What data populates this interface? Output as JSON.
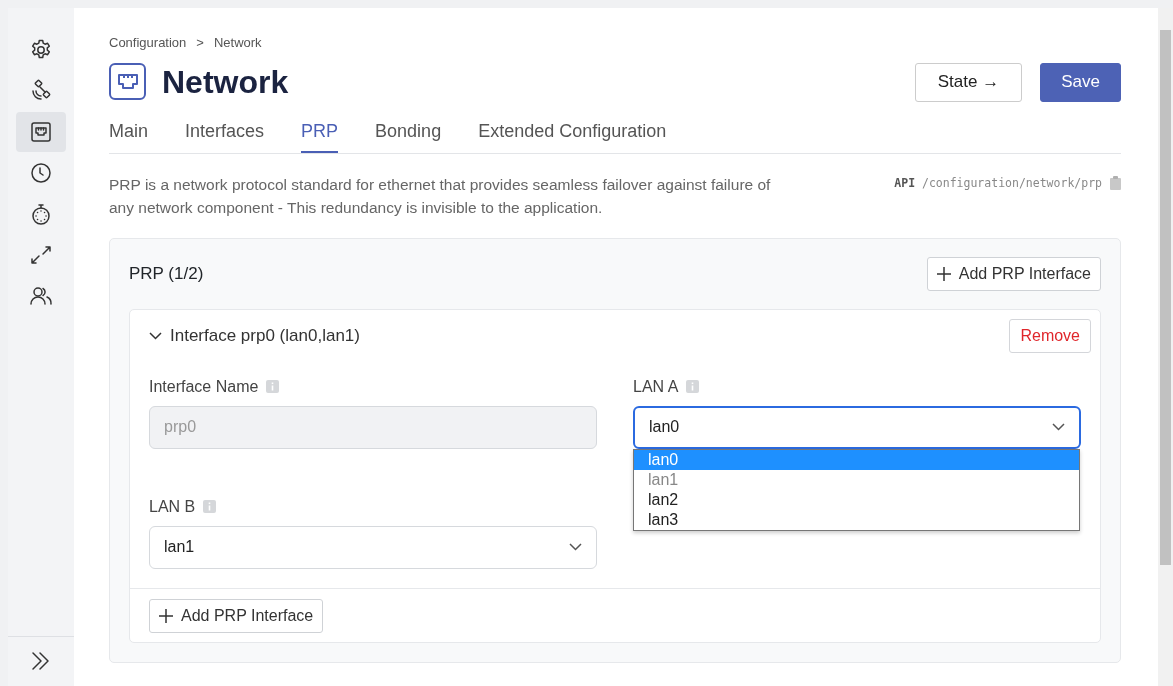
{
  "sidebar": {
    "items": [
      {
        "selected": false
      },
      {
        "selected": false
      },
      {
        "selected": true
      },
      {
        "selected": false
      },
      {
        "selected": false
      },
      {
        "selected": false
      },
      {
        "selected": false
      }
    ]
  },
  "breadcrumb": [
    "Configuration",
    "Network"
  ],
  "breadcrumb_separator": ">",
  "title": "Network",
  "header_buttons": [
    {
      "label": "State →",
      "kind": "outline"
    },
    {
      "label": "Save",
      "kind": "primary"
    }
  ],
  "tabs": [
    {
      "label": "Main",
      "selected": false
    },
    {
      "label": "Interfaces",
      "selected": false
    },
    {
      "label": "PRP",
      "selected": true
    },
    {
      "label": "Bonding",
      "selected": false
    },
    {
      "label": "Extended Configuration",
      "selected": false
    }
  ],
  "description": "PRP is a network protocol standard for ethernet that provides seamless failover against failure of any network component - This redundancy is invisible to the application.",
  "api": {
    "label": "API",
    "path": "/configuration/network/prp"
  },
  "section": {
    "title": "PRP (1/2)",
    "add_button": "Add PRP Interface",
    "interfaces": [
      {
        "title": "Interface prp0 (lan0,lan1)",
        "expanded": true,
        "remove_button": "Remove",
        "field_rows": [
          [
            {
              "label": "Interface Name",
              "kind": "text",
              "value": "prp0",
              "disabled": true
            },
            {
              "label": "LAN A",
              "kind": "select",
              "value": "lan0",
              "focused": true,
              "options": [
                {
                  "label": "lan0",
                  "selected": true,
                  "disabled": false
                },
                {
                  "label": "lan1",
                  "selected": false,
                  "disabled": true
                },
                {
                  "label": "lan2",
                  "selected": false,
                  "disabled": false
                },
                {
                  "label": "lan3",
                  "selected": false,
                  "disabled": false
                }
              ]
            }
          ],
          [
            {
              "label": "LAN B",
              "kind": "select",
              "value": "lan1",
              "focused": false
            }
          ]
        ]
      }
    ],
    "footer_button": "Add PRP Interface"
  }
}
